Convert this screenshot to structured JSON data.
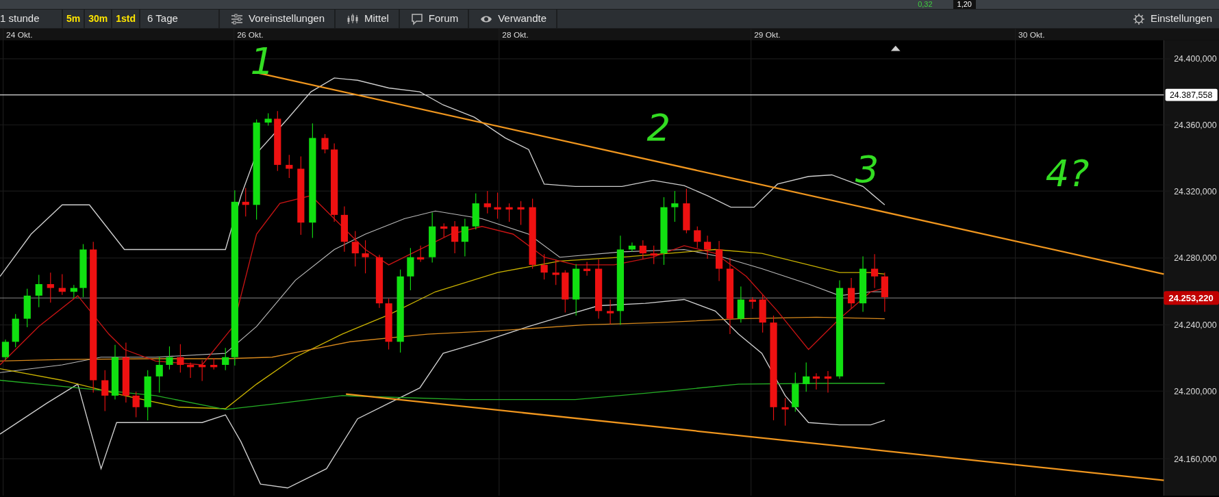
{
  "top_strip": [
    {
      "text": "0,32",
      "kind": "change"
    },
    {
      "text": "1,20",
      "kind": "value"
    }
  ],
  "toolbar": {
    "range": "1 stunde",
    "intervals": [
      "5m",
      "30m",
      "1std"
    ],
    "period": "6 Tage",
    "buttons": [
      {
        "label": "Voreinstellungen"
      },
      {
        "label": "Mittel"
      },
      {
        "label": "Forum"
      },
      {
        "label": "Verwandte"
      }
    ],
    "settings": "Einstellungen"
  },
  "chart": {
    "date_labels": [
      "24 Okt.",
      "26 Okt.",
      "28 Okt.",
      "29 Okt.",
      "30 Okt."
    ],
    "price_labels": [
      "24.400,000",
      "24.360,000",
      "24.320,000",
      "24.280,000",
      "24.240,000",
      "24.200,000",
      "24.160,000"
    ],
    "marked_price": "24.387,558",
    "last_price": "24.253,220",
    "annotations": [
      "1",
      "2",
      "3",
      "4?"
    ]
  }
}
